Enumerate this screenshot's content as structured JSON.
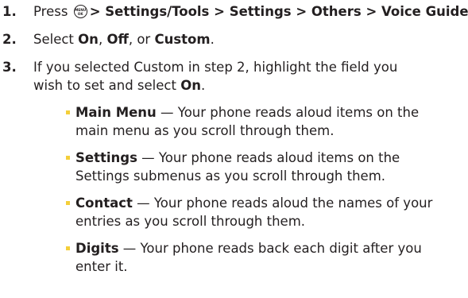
{
  "steps": [
    {
      "number": "1.",
      "prefix": "Press",
      "key_icon": "menu-ok-key-icon",
      "key_top": "MENU",
      "key_bottom": "OK",
      "path": "> Settings/Tools > Settings > Others > Voice Guide",
      "suffix": "."
    },
    {
      "number": "2.",
      "prefix": "Select ",
      "opt1": "On",
      "sep1": ", ",
      "opt2": "Off",
      "sep2": ", or ",
      "opt3": "Custom",
      "suffix": "."
    },
    {
      "number": "3.",
      "line1": "If you selected Custom in step 2, highlight the field you",
      "line2_prefix": "wish to set and select ",
      "line2_bold": "On",
      "line2_suffix": "."
    }
  ],
  "bullets": [
    {
      "term": "Main Menu",
      "line1": " — Your phone reads aloud items on the",
      "line2": "main menu as you scroll through them."
    },
    {
      "term": "Settings",
      "line1": " — Your phone reads aloud items on the",
      "line2": "Settings submenus as you scroll through them."
    },
    {
      "term": "Contact",
      "line1": " — Your phone reads aloud the names of your",
      "line2": "entries as you scroll through them."
    },
    {
      "term": "Digits",
      "line1": " — Your phone reads back each digit after you",
      "line2": "enter it."
    }
  ],
  "colors": {
    "text": "#231f20",
    "bullet": "#f4cf3a"
  }
}
